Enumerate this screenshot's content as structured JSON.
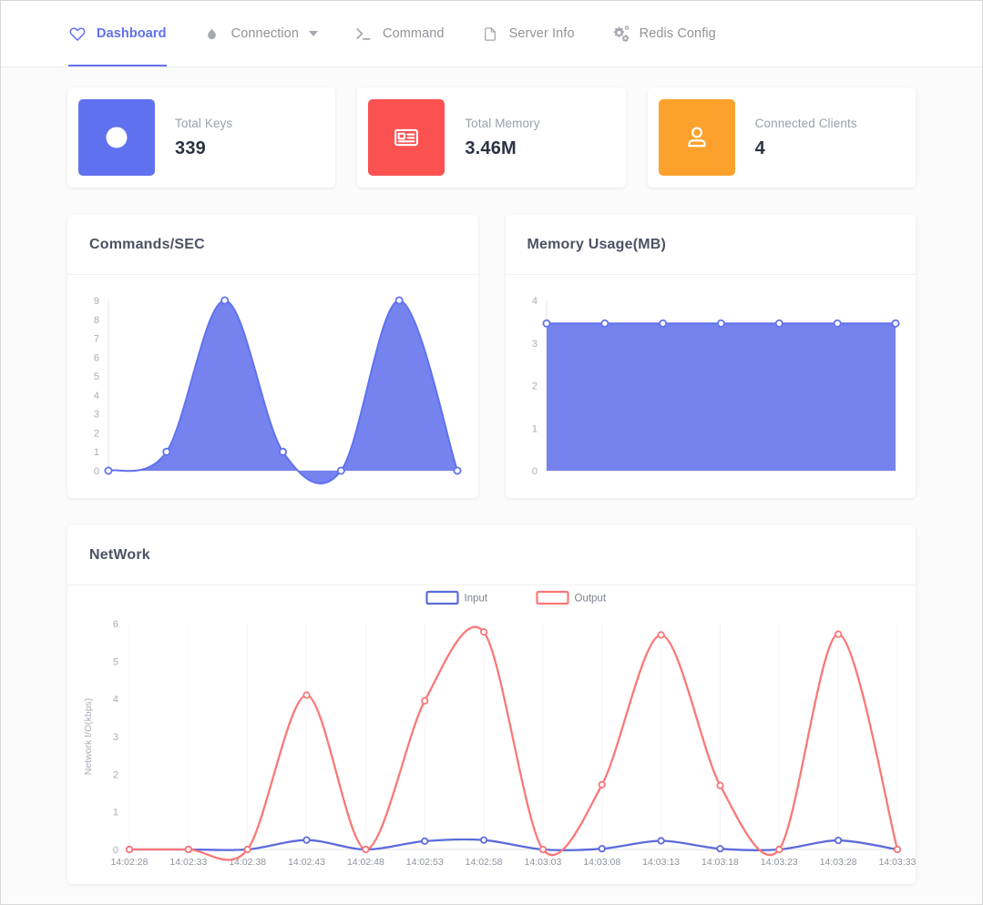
{
  "nav": {
    "items": [
      {
        "label": "Dashboard",
        "icon": "heart-icon",
        "active": true,
        "dropdown": false
      },
      {
        "label": "Connection",
        "icon": "flame-icon",
        "active": false,
        "dropdown": true
      },
      {
        "label": "Command",
        "icon": "terminal-icon",
        "active": false,
        "dropdown": false
      },
      {
        "label": "Server Info",
        "icon": "file-icon",
        "active": false,
        "dropdown": false
      },
      {
        "label": "Redis Config",
        "icon": "gears-icon",
        "active": false,
        "dropdown": false
      }
    ],
    "active_color": "#6071ef",
    "inactive_color": "#909399"
  },
  "stats": [
    {
      "label": "Total Keys",
      "value": "339",
      "color": "#6071ef",
      "icon": "database-circle-icon"
    },
    {
      "label": "Total Memory",
      "value": "3.46M",
      "color": "#fb5151",
      "icon": "memory-card-icon"
    },
    {
      "label": "Connected Clients",
      "value": "4",
      "color": "#fca22c",
      "icon": "user-icon"
    }
  ],
  "cards": {
    "commands_title": "Commands/SEC",
    "memory_title": "Memory Usage(MB)",
    "network_title": "NetWork"
  },
  "chart_data": [
    {
      "id": "commands",
      "type": "area",
      "title": "Commands/SEC",
      "xlabel": "",
      "ylabel": "",
      "ylim": [
        0,
        9
      ],
      "yticks": [
        0,
        1,
        2,
        3,
        4,
        5,
        6,
        7,
        8,
        9
      ],
      "grid": false,
      "legend": "none",
      "color": "#6071ef",
      "fill": "#6a78ee",
      "x": [
        0,
        1,
        2,
        3,
        4,
        5,
        6
      ],
      "values": [
        0,
        1,
        9,
        1,
        0,
        9,
        0
      ]
    },
    {
      "id": "memory",
      "type": "area",
      "title": "Memory Usage(MB)",
      "xlabel": "",
      "ylabel": "",
      "ylim": [
        0,
        4
      ],
      "yticks": [
        0,
        1,
        2,
        3,
        4
      ],
      "grid": false,
      "legend": "none",
      "color": "#6071ef",
      "fill": "#6a78ee",
      "x": [
        0,
        1,
        2,
        3,
        4,
        5,
        6
      ],
      "values": [
        3.46,
        3.46,
        3.46,
        3.46,
        3.46,
        3.46,
        3.46
      ]
    },
    {
      "id": "network",
      "type": "line",
      "title": "NetWork",
      "xlabel": "",
      "ylabel": "Network I/O(kbps)",
      "ylim": [
        0,
        6
      ],
      "yticks": [
        0,
        1,
        2,
        3,
        4,
        5,
        6
      ],
      "grid": true,
      "legend": "top",
      "categories": [
        "14:02:28",
        "14:02:33",
        "14:02:38",
        "14:02:43",
        "14:02:48",
        "14:02:53",
        "14:02:58",
        "14:03:03",
        "14:03:08",
        "14:03:13",
        "14:03:18",
        "14:03:23",
        "14:03:28",
        "14:03:33"
      ],
      "series": [
        {
          "name": "Input",
          "color": "#5c6bdb",
          "values": [
            0,
            0,
            0,
            0.25,
            0,
            0.22,
            0.25,
            0,
            0.02,
            0.23,
            0.02,
            0,
            0.24,
            0
          ]
        },
        {
          "name": "Output",
          "color": "#fa7878",
          "values": [
            0,
            0,
            0,
            4.1,
            0,
            3.95,
            5.78,
            0,
            1.72,
            5.7,
            1.7,
            0,
            5.72,
            0
          ]
        }
      ]
    }
  ]
}
